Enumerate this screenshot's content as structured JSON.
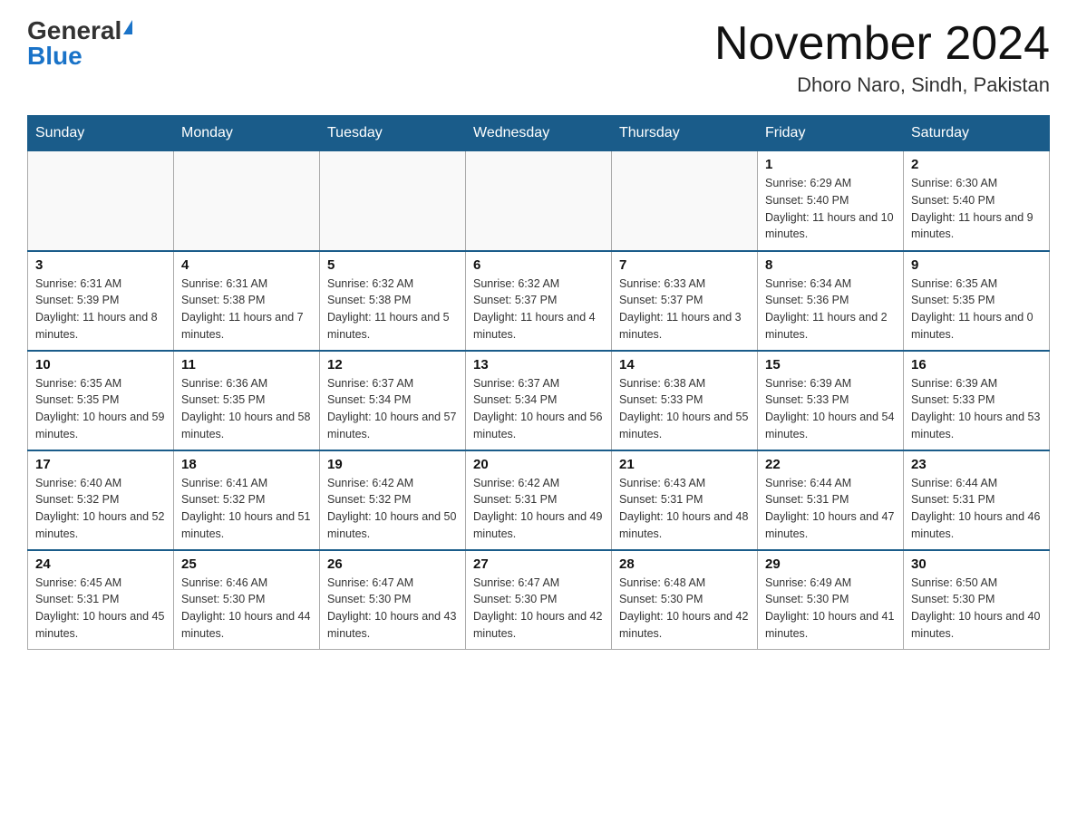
{
  "header": {
    "logo_general": "General",
    "logo_blue": "Blue",
    "month_title": "November 2024",
    "location": "Dhoro Naro, Sindh, Pakistan"
  },
  "weekdays": [
    "Sunday",
    "Monday",
    "Tuesday",
    "Wednesday",
    "Thursday",
    "Friday",
    "Saturday"
  ],
  "weeks": [
    [
      {
        "day": "",
        "info": ""
      },
      {
        "day": "",
        "info": ""
      },
      {
        "day": "",
        "info": ""
      },
      {
        "day": "",
        "info": ""
      },
      {
        "day": "",
        "info": ""
      },
      {
        "day": "1",
        "info": "Sunrise: 6:29 AM\nSunset: 5:40 PM\nDaylight: 11 hours and 10 minutes."
      },
      {
        "day": "2",
        "info": "Sunrise: 6:30 AM\nSunset: 5:40 PM\nDaylight: 11 hours and 9 minutes."
      }
    ],
    [
      {
        "day": "3",
        "info": "Sunrise: 6:31 AM\nSunset: 5:39 PM\nDaylight: 11 hours and 8 minutes."
      },
      {
        "day": "4",
        "info": "Sunrise: 6:31 AM\nSunset: 5:38 PM\nDaylight: 11 hours and 7 minutes."
      },
      {
        "day": "5",
        "info": "Sunrise: 6:32 AM\nSunset: 5:38 PM\nDaylight: 11 hours and 5 minutes."
      },
      {
        "day": "6",
        "info": "Sunrise: 6:32 AM\nSunset: 5:37 PM\nDaylight: 11 hours and 4 minutes."
      },
      {
        "day": "7",
        "info": "Sunrise: 6:33 AM\nSunset: 5:37 PM\nDaylight: 11 hours and 3 minutes."
      },
      {
        "day": "8",
        "info": "Sunrise: 6:34 AM\nSunset: 5:36 PM\nDaylight: 11 hours and 2 minutes."
      },
      {
        "day": "9",
        "info": "Sunrise: 6:35 AM\nSunset: 5:35 PM\nDaylight: 11 hours and 0 minutes."
      }
    ],
    [
      {
        "day": "10",
        "info": "Sunrise: 6:35 AM\nSunset: 5:35 PM\nDaylight: 10 hours and 59 minutes."
      },
      {
        "day": "11",
        "info": "Sunrise: 6:36 AM\nSunset: 5:35 PM\nDaylight: 10 hours and 58 minutes."
      },
      {
        "day": "12",
        "info": "Sunrise: 6:37 AM\nSunset: 5:34 PM\nDaylight: 10 hours and 57 minutes."
      },
      {
        "day": "13",
        "info": "Sunrise: 6:37 AM\nSunset: 5:34 PM\nDaylight: 10 hours and 56 minutes."
      },
      {
        "day": "14",
        "info": "Sunrise: 6:38 AM\nSunset: 5:33 PM\nDaylight: 10 hours and 55 minutes."
      },
      {
        "day": "15",
        "info": "Sunrise: 6:39 AM\nSunset: 5:33 PM\nDaylight: 10 hours and 54 minutes."
      },
      {
        "day": "16",
        "info": "Sunrise: 6:39 AM\nSunset: 5:33 PM\nDaylight: 10 hours and 53 minutes."
      }
    ],
    [
      {
        "day": "17",
        "info": "Sunrise: 6:40 AM\nSunset: 5:32 PM\nDaylight: 10 hours and 52 minutes."
      },
      {
        "day": "18",
        "info": "Sunrise: 6:41 AM\nSunset: 5:32 PM\nDaylight: 10 hours and 51 minutes."
      },
      {
        "day": "19",
        "info": "Sunrise: 6:42 AM\nSunset: 5:32 PM\nDaylight: 10 hours and 50 minutes."
      },
      {
        "day": "20",
        "info": "Sunrise: 6:42 AM\nSunset: 5:31 PM\nDaylight: 10 hours and 49 minutes."
      },
      {
        "day": "21",
        "info": "Sunrise: 6:43 AM\nSunset: 5:31 PM\nDaylight: 10 hours and 48 minutes."
      },
      {
        "day": "22",
        "info": "Sunrise: 6:44 AM\nSunset: 5:31 PM\nDaylight: 10 hours and 47 minutes."
      },
      {
        "day": "23",
        "info": "Sunrise: 6:44 AM\nSunset: 5:31 PM\nDaylight: 10 hours and 46 minutes."
      }
    ],
    [
      {
        "day": "24",
        "info": "Sunrise: 6:45 AM\nSunset: 5:31 PM\nDaylight: 10 hours and 45 minutes."
      },
      {
        "day": "25",
        "info": "Sunrise: 6:46 AM\nSunset: 5:30 PM\nDaylight: 10 hours and 44 minutes."
      },
      {
        "day": "26",
        "info": "Sunrise: 6:47 AM\nSunset: 5:30 PM\nDaylight: 10 hours and 43 minutes."
      },
      {
        "day": "27",
        "info": "Sunrise: 6:47 AM\nSunset: 5:30 PM\nDaylight: 10 hours and 42 minutes."
      },
      {
        "day": "28",
        "info": "Sunrise: 6:48 AM\nSunset: 5:30 PM\nDaylight: 10 hours and 42 minutes."
      },
      {
        "day": "29",
        "info": "Sunrise: 6:49 AM\nSunset: 5:30 PM\nDaylight: 10 hours and 41 minutes."
      },
      {
        "day": "30",
        "info": "Sunrise: 6:50 AM\nSunset: 5:30 PM\nDaylight: 10 hours and 40 minutes."
      }
    ]
  ]
}
